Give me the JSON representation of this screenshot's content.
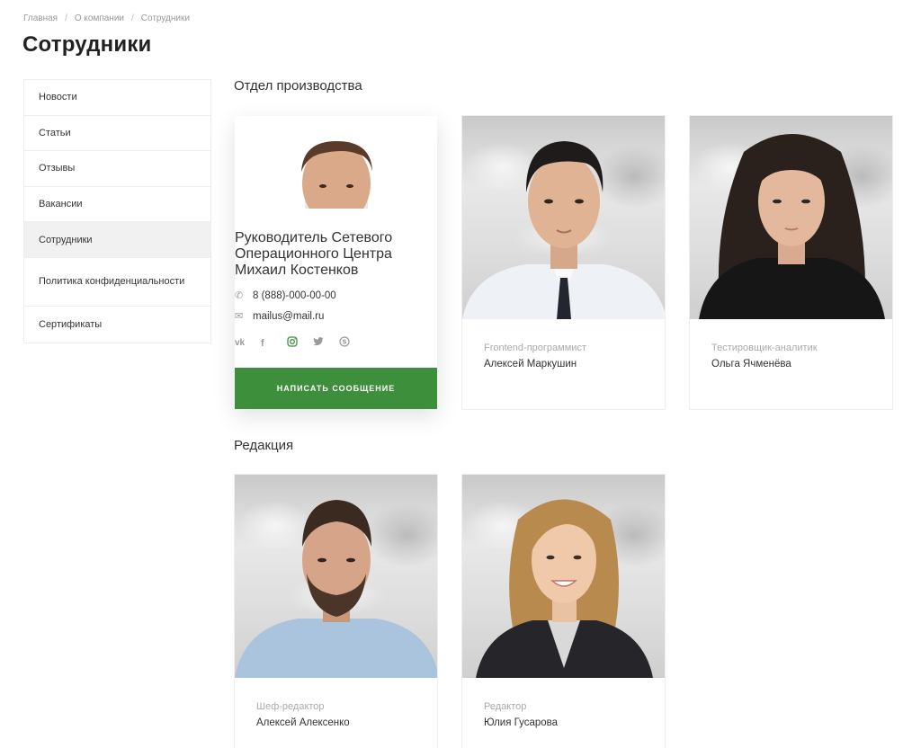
{
  "breadcrumbs": [
    "Главная",
    "О компании",
    "Сотрудники"
  ],
  "page_title": "Сотрудники",
  "sidebar": {
    "items": [
      {
        "label": "Новости"
      },
      {
        "label": "Статьи"
      },
      {
        "label": "Отзывы"
      },
      {
        "label": "Вакансии"
      },
      {
        "label": "Сотрудники"
      },
      {
        "label": "Политика конфиденциальности"
      },
      {
        "label": "Сертификаты"
      }
    ]
  },
  "sections": [
    {
      "title": "Отдел производства"
    },
    {
      "title": "Редакция"
    }
  ],
  "featured": {
    "role": "Руководитель Сетевого Операционного Центра",
    "name": "Михаил Костенков",
    "phone": "8 (888)-000-00-00",
    "email": "mailus@mail.ru",
    "socials": [
      "vk-icon",
      "facebook-icon",
      "instagram-icon",
      "twitter-icon",
      "skype-icon"
    ],
    "button": "Написать сообщение",
    "accent": "#3d8f3c"
  },
  "cards": [
    {
      "role": "Frontend-программист",
      "name": "Алексей Маркушин"
    },
    {
      "role": "Тестировщик-аналитик",
      "name": "Ольга Ячменёва"
    },
    {
      "role": "Шеф-редактор",
      "name": "Алексей Алексенко"
    },
    {
      "role": "Редактор",
      "name": "Юлия Гусарова"
    }
  ]
}
